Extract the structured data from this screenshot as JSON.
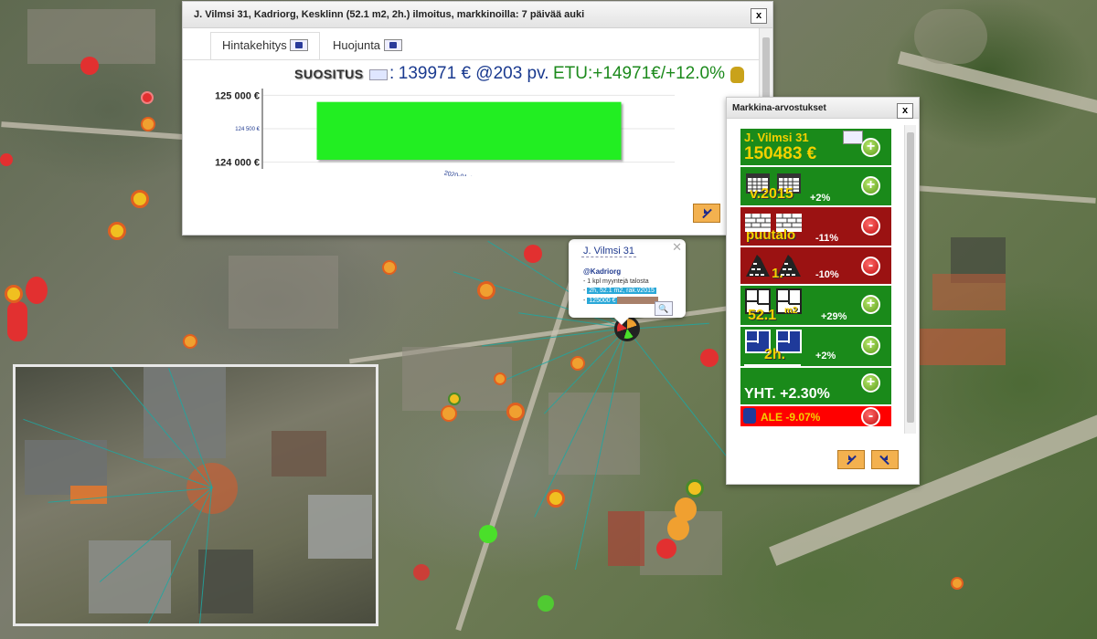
{
  "listing": {
    "title": "J. Vilmsi 31, Kadriorg, Kesklinn (52.1 m2, 2h.) ilmoitus, markkinoilla: 7 päivää auki",
    "close": "x",
    "tabs": [
      {
        "label": "Hintakehitys",
        "active": true
      },
      {
        "label": "Huojunta",
        "active": false
      }
    ],
    "recommendation": {
      "label": "SUOSITUS",
      "separator": ":",
      "price_text": "139971 € @203 pv",
      "dot": ".",
      "etu_text": "ETU:+14971€/+12.0%"
    }
  },
  "chart_data": {
    "type": "bar",
    "categories": [
      "2020-01-13"
    ],
    "values": [
      124900
    ],
    "ylim": [
      123900,
      125100
    ],
    "yticks": [
      {
        "value": 125000,
        "label": "125 000 €",
        "minor": false
      },
      {
        "value": 124500,
        "label": "124 500 €",
        "minor": true
      },
      {
        "value": 124000,
        "label": "124 000 €",
        "minor": false
      }
    ],
    "bar_color": "#22ee22"
  },
  "market": {
    "title": "Markkina-arvostukset",
    "close": "x",
    "address": "J. Vilmsi 31",
    "price": "150483 €",
    "rows": [
      {
        "label": "v.2015",
        "pct": "+2%",
        "tone": "green",
        "sign": "+"
      },
      {
        "label": "puutalo",
        "pct": "-11%",
        "tone": "red",
        "sign": "-"
      },
      {
        "label": "1.",
        "pct": "-10%",
        "tone": "red",
        "sign": "-"
      },
      {
        "label": "52.1",
        "unit": "m2",
        "pct": "+29%",
        "tone": "green",
        "sign": "+"
      },
      {
        "label": "2h.",
        "pct": "+2%",
        "tone": "green",
        "sign": "+"
      }
    ],
    "total": "YHT. +2.30%",
    "discount": "ALE -9.07%",
    "colors": {
      "green": "#1a8a1a",
      "red": "#9b1212",
      "alert": "#ff0000",
      "yellow": "#f4d000"
    }
  },
  "popup": {
    "title": "J. Vilmsi 31",
    "area": "@Kadriorg",
    "line1": "- 1 kpl myyntejä talosta",
    "line2_prefix": "- ",
    "line2_badge": "2h, 52.1 m2, rak.v2015",
    "line3_prefix": "- ",
    "line3_badge": "125000 €"
  }
}
